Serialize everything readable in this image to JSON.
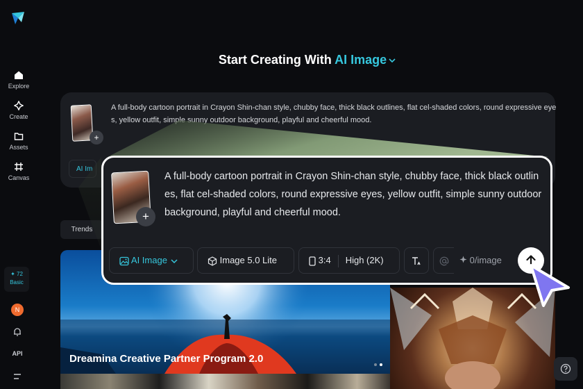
{
  "headline": {
    "prefix": "Start Creating With",
    "accent": "AI Image"
  },
  "sidebar": {
    "items": [
      {
        "label": "Explore",
        "icon": "home-icon"
      },
      {
        "label": "Create",
        "icon": "sparkle-icon"
      },
      {
        "label": "Assets",
        "icon": "folder-icon"
      },
      {
        "label": "Canvas",
        "icon": "canvas-icon"
      }
    ],
    "credits": {
      "count": "✦ 72",
      "plan": "Basic"
    },
    "avatar_initial": "N",
    "api_label": "API"
  },
  "background_card": {
    "prompt": "A full-body cartoon portrait in Crayon Shin-chan style, chubby face, thick black outlines, flat cel-shaded colors, round expressive eyes, yellow outfit, simple sunny outdoor background, playful and cheerful mood.",
    "chip_label": "AI Im"
  },
  "tabs": {
    "trends": "Trends"
  },
  "prompt_card": {
    "text": "A full-body cartoon portrait in Crayon Shin-chan style, chubby face, thick black outlines, flat cel-shaded colors, round expressive eyes, yellow outfit, simple sunny outdoor background, playful and cheerful mood.",
    "mode": "AI Image",
    "model": "Image 5.0 Lite",
    "ratio": "3:4",
    "quality": "High (2K)",
    "cost": "0/image"
  },
  "hero": {
    "title": "Dreamina Creative Partner Program 2.0"
  },
  "colors": {
    "accent": "#36c7dd",
    "cursor": "#7f76f0",
    "background": "#0b0c0f",
    "card": "#1b1d22"
  }
}
